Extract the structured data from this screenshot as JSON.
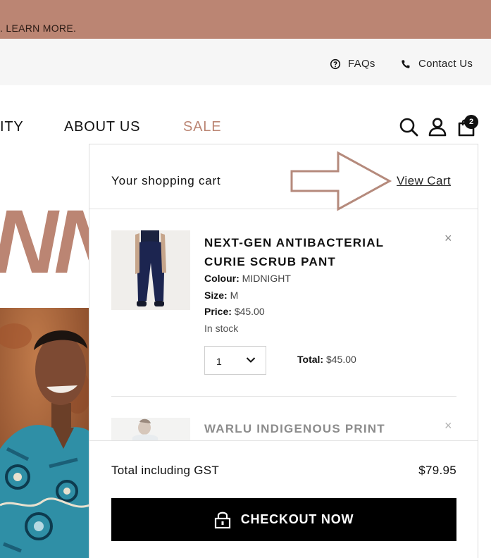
{
  "promo": {
    "text": ". LEARN MORE."
  },
  "utility": {
    "faq_label": "FAQs",
    "contact_label": "Contact Us"
  },
  "nav": {
    "items": [
      "ITY",
      "ABOUT US",
      "SALE"
    ],
    "cart_count": "2"
  },
  "hero": {
    "text": "NN"
  },
  "cart": {
    "title": "Your shopping cart",
    "view_cart_label": "View Cart",
    "items": [
      {
        "name": "NEXT-GEN ANTIBACTERIAL CURIE SCRUB PANT",
        "colour_label": "Colour:",
        "colour": "MIDNIGHT",
        "size_label": "Size:",
        "size": "M",
        "price_label": "Price:",
        "price": "$45.00",
        "stock": "In stock",
        "quantity": "1",
        "total_label": "Total:",
        "total": "$45.00",
        "remove_symbol": "×"
      },
      {
        "name": "WARLU INDIGENOUS PRINT",
        "remove_symbol": "×"
      }
    ],
    "total_label": "Total including GST",
    "total_value": "$79.95",
    "checkout_label": "CHECKOUT NOW"
  },
  "colors": {
    "accent": "#bb8573",
    "promo_bg": "#bb8573",
    "checkout_bg": "#000000",
    "annotation_arrow": "#b58a7c"
  },
  "icons": [
    "question-circle-icon",
    "phone-icon",
    "search-icon",
    "account-icon",
    "shopping-bag-icon",
    "close-icon",
    "chevron-down-icon",
    "lock-icon",
    "arrow-right-icon"
  ]
}
